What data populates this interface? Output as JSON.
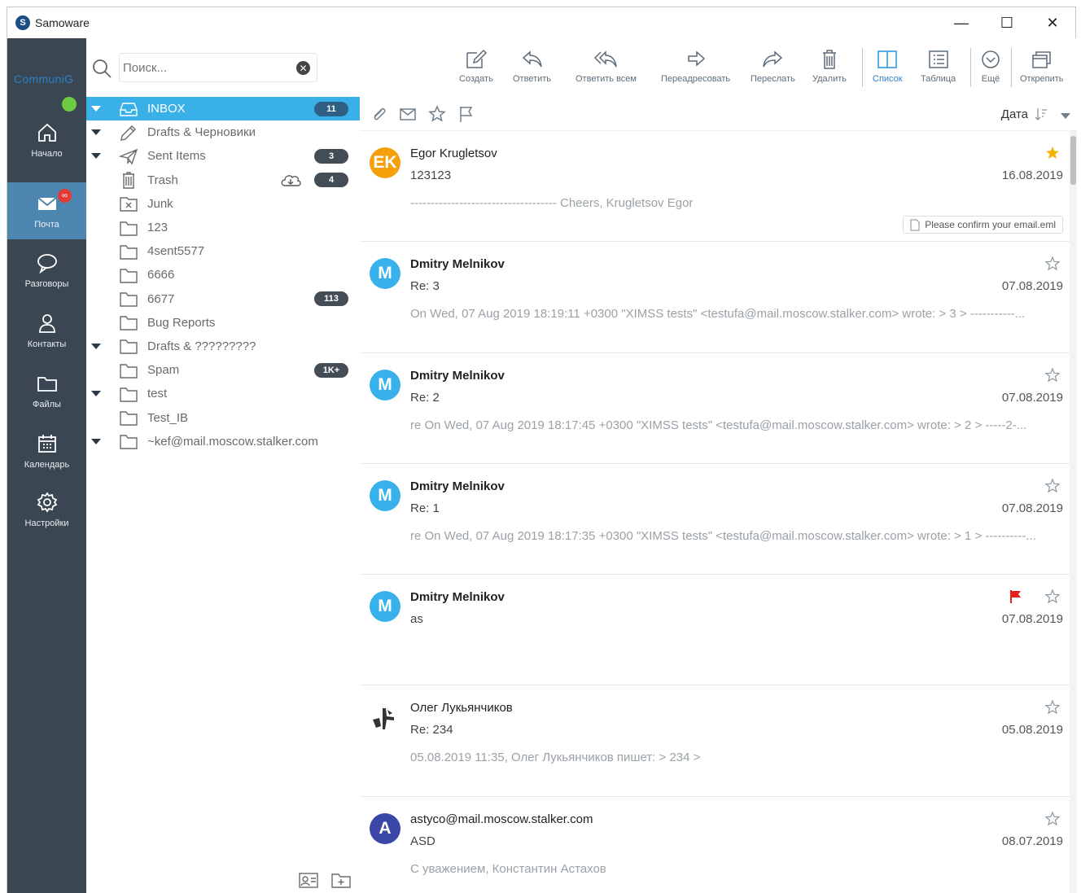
{
  "window": {
    "app_title": "Samoware",
    "logo_letter": "S",
    "min": "—",
    "max": "☐",
    "close": "✕"
  },
  "rail": {
    "brand": "CommuniG",
    "items": [
      {
        "label": "Начало",
        "icon": "home-icon"
      },
      {
        "label": "Почта",
        "icon": "mail-icon",
        "badge": "∞"
      },
      {
        "label": "Разговоры",
        "icon": "chat-icon"
      },
      {
        "label": "Контакты",
        "icon": "contacts-icon"
      },
      {
        "label": "Файлы",
        "icon": "folder-icon"
      },
      {
        "label": "Календарь",
        "icon": "calendar-icon"
      },
      {
        "label": "Настройки",
        "icon": "gear-icon"
      }
    ],
    "colors": {
      "rail": "#3a4651",
      "active": "#4e86b2",
      "presence": "#6ccb3e"
    }
  },
  "search": {
    "placeholder": "Поиск...",
    "clear": "✕"
  },
  "folders": [
    {
      "name": "INBOX",
      "badge": "11",
      "caret": true,
      "icon": "inbox-icon"
    },
    {
      "name": "Drafts & Черновики",
      "badge": "",
      "caret": true,
      "icon": "pencil-icon"
    },
    {
      "name": "Sent Items",
      "badge": "3",
      "caret": true,
      "icon": "send-icon"
    },
    {
      "name": "Trash",
      "badge": "4",
      "caret": false,
      "icon": "trash-icon"
    },
    {
      "name": "Junk",
      "badge": "",
      "caret": false,
      "icon": "junk-icon"
    },
    {
      "name": "123",
      "badge": "",
      "caret": false,
      "icon": "folder-icon"
    },
    {
      "name": "4sent5577",
      "badge": "",
      "caret": false,
      "icon": "folder-icon"
    },
    {
      "name": "6666",
      "badge": "",
      "caret": false,
      "icon": "folder-icon"
    },
    {
      "name": "6677",
      "badge": "113",
      "caret": false,
      "icon": "folder-icon"
    },
    {
      "name": "Bug Reports",
      "badge": "",
      "caret": false,
      "icon": "folder-icon"
    },
    {
      "name": "Drafts & ?????????",
      "badge": "",
      "caret": true,
      "icon": "folder-icon"
    },
    {
      "name": "Spam",
      "badge": "1K+",
      "caret": false,
      "icon": "folder-icon"
    },
    {
      "name": "test",
      "badge": "",
      "caret": true,
      "icon": "folder-icon"
    },
    {
      "name": "Test_IB",
      "badge": "",
      "caret": false,
      "icon": "folder-icon"
    },
    {
      "name": "~kef@mail.moscow.stalker.com",
      "badge": "",
      "caret": true,
      "icon": "folder-icon"
    }
  ],
  "toolbar": {
    "buttons": [
      {
        "label": "Создать",
        "icon": "compose-icon"
      },
      {
        "label": "Ответить",
        "icon": "reply-icon"
      },
      {
        "label": "Ответить всем",
        "icon": "reply-all-icon"
      },
      {
        "label": "Переадресовать",
        "icon": "redirect-icon"
      },
      {
        "label": "Переслать",
        "icon": "forward-icon"
      },
      {
        "label": "Удалить",
        "icon": "trash-icon"
      },
      {
        "label": "Список",
        "icon": "list-view-icon"
      },
      {
        "label": "Таблица",
        "icon": "table-view-icon"
      },
      {
        "label": "Ещё",
        "icon": "more-icon"
      },
      {
        "label": "Открепить",
        "icon": "detach-icon"
      }
    ]
  },
  "list_header": {
    "sort_label": "Дата"
  },
  "messages": [
    {
      "sender": "Egor Krugletsov",
      "subject": "123123",
      "preview": "------------------------------------ Cheers,  Krugletsov Egor",
      "date": "16.08.2019",
      "avatar": "EK",
      "avatar_color": "#f5a00a",
      "starred": true,
      "flagged": false,
      "attachment": "Please confirm your email.eml",
      "bold": false
    },
    {
      "sender": "Dmitry Melnikov",
      "subject": "Re: 3",
      "preview": "On Wed, 07 Aug 2019 18:19:11 +0300   \"XIMSS tests\" <testufa@mail.moscow.stalker.com> wrote: > 3 > -----------...",
      "date": "07.08.2019",
      "avatar": "M",
      "avatar_color": "#39b2ec",
      "starred": false,
      "flagged": false,
      "attachment": "",
      "bold": true
    },
    {
      "sender": "Dmitry Melnikov",
      "subject": "Re: 2",
      "preview": "re  On Wed, 07 Aug 2019 18:17:45 +0300   \"XIMSS tests\" <testufa@mail.moscow.stalker.com> wrote: > 2 > -----2-...",
      "date": "07.08.2019",
      "avatar": "M",
      "avatar_color": "#39b2ec",
      "starred": false,
      "flagged": false,
      "attachment": "",
      "bold": true
    },
    {
      "sender": "Dmitry Melnikov",
      "subject": "Re: 1",
      "preview": "re  On Wed, 07 Aug 2019 18:17:35 +0300   \"XIMSS tests\" <testufa@mail.moscow.stalker.com> wrote: > 1 > ----------...",
      "date": "07.08.2019",
      "avatar": "M",
      "avatar_color": "#39b2ec",
      "starred": false,
      "flagged": false,
      "attachment": "",
      "bold": true
    },
    {
      "sender": "Dmitry Melnikov",
      "subject": "as",
      "preview": "",
      "date": "07.08.2019",
      "avatar": "M",
      "avatar_color": "#39b2ec",
      "starred": false,
      "flagged": true,
      "attachment": "",
      "bold": true
    },
    {
      "sender": "Олег Лукьянчиков",
      "subject": "Re: 234",
      "preview": " 05.08.2019 11:35, Олег Лукьянчиков пишет: > 234 >",
      "date": "05.08.2019",
      "avatar": "",
      "avatar_color": "",
      "starred": false,
      "flagged": false,
      "attachment": "",
      "bold": false
    },
    {
      "sender": "astyco@mail.moscow.stalker.com",
      "subject": "ASD",
      "preview": "С уважением,  Константин Астахов",
      "date": "08.07.2019",
      "avatar": "A",
      "avatar_color": "#3b47a6",
      "starred": false,
      "flagged": false,
      "attachment": "",
      "bold": false
    }
  ],
  "colors": {
    "selected": "#3ab0e8",
    "badge": "#444d56",
    "star_on": "#f5b400",
    "flag": "#e3211c"
  }
}
